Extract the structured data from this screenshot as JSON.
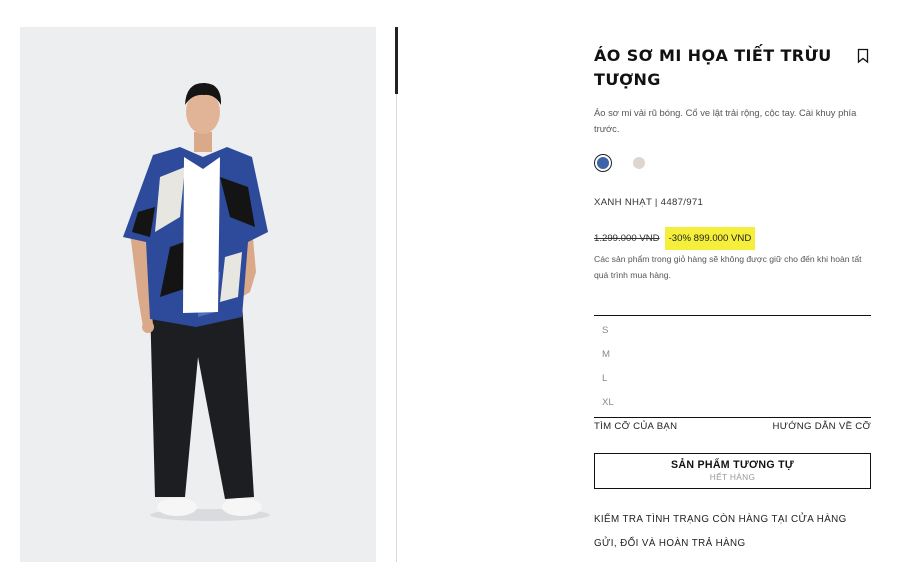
{
  "product": {
    "title": "ÁO SƠ MI HỌA TIẾT TRỪU TƯỢNG",
    "description": "Áo sơ mi vải rũ bóng. Cổ ve lật trải rộng, cộc tay. Cài khuy phía trước.",
    "color_ref": "XANH NHẠT | 4487/971",
    "old_price": "1.299.000 VND",
    "sale_price": "-30% 899.000 VND",
    "cart_note": "Các sản phẩm trong giỏ hàng sẽ không được giữ cho đến khi hoàn tất quá trình mua hàng.",
    "colors": [
      {
        "name": "blue",
        "hex": "#3d63a8",
        "selected": true
      },
      {
        "name": "beige",
        "hex": "#dcd6cf",
        "selected": false
      }
    ],
    "sizes": [
      "S",
      "M",
      "L",
      "XL"
    ]
  },
  "links": {
    "find_size": "TÌM CỠ CỦA BẠN",
    "size_guide": "HƯỚNG DẪN VỀ CỠ",
    "similar": "SẢN PHẨM TƯƠNG TỰ",
    "sold_out": "HẾT HÀNG",
    "stock_check": "KIỂM TRA TÌNH TRẠNG CÒN HÀNG TẠI CỬA HÀNG",
    "returns": "GỬI, ĐỔI VÀ HOÀN TRẢ HÀNG"
  },
  "icons": {
    "bookmark": "bookmark-icon"
  },
  "colors": {
    "accent_highlight": "#f5ee3a",
    "text": "#111111",
    "muted": "#8a8a8a"
  }
}
